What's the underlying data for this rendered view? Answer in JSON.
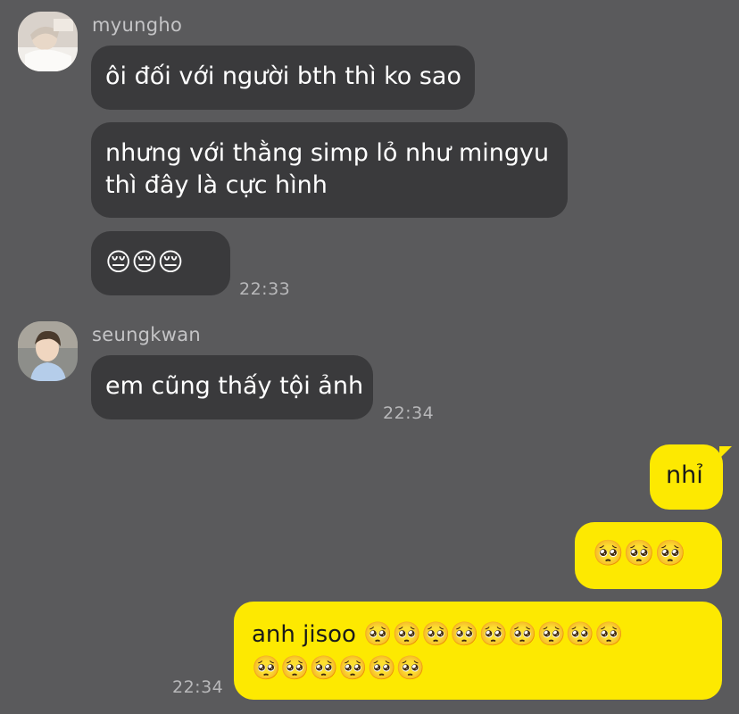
{
  "messages": {
    "group1": {
      "sender": "myungho",
      "bubbles": [
        "ôi đối với người bth thì ko sao",
        "nhưng với thằng simp lỏ như mingyu",
        "thì đây là cực hình",
        "😔😔😔"
      ],
      "time": "22:33"
    },
    "group2": {
      "sender": "seungkwan",
      "bubbles": [
        "em cũng thấy tội ảnh"
      ],
      "time": "22:34"
    },
    "group3": {
      "bubbles": [
        "nhỉ",
        "🥺🥺🥺",
        "anh jisoo 🥺🥺🥺🥺🥺🥺🥺🥺🥺",
        "🥺🥺🥺🥺🥺🥺"
      ],
      "time": "22:34"
    }
  },
  "colors": {
    "background": "#5a5a5c",
    "incoming_bubble": "#3a3a3c",
    "outgoing_bubble": "#fde901"
  }
}
